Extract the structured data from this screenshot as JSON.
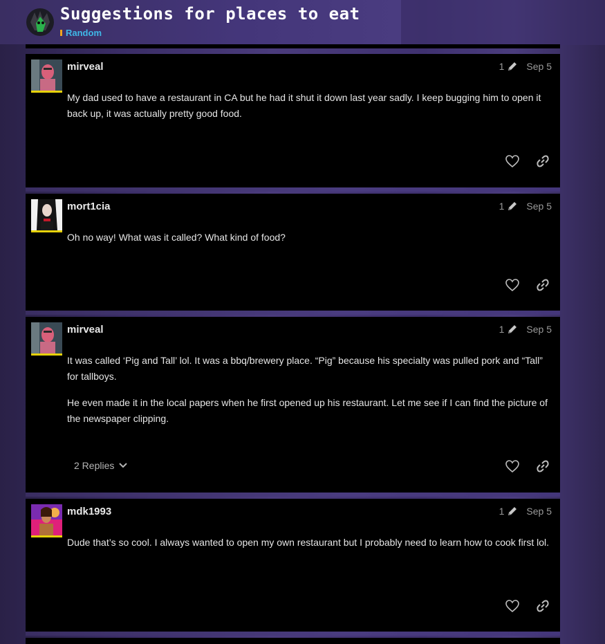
{
  "topic": {
    "title": "Suggestions for places to eat",
    "category": "Random"
  },
  "colors": {
    "accent_user_border": "#e6d20a",
    "category_swatch": "#f0a41f",
    "category_text": "#3fb8e8",
    "post_background": "#000000"
  },
  "icons": {
    "like": "heart-icon",
    "share": "link-icon",
    "edit": "pencil-icon",
    "expand": "chevron-down-icon"
  },
  "posts": [
    {
      "username": "mirveal",
      "edit_count": "1",
      "date": "Sep 5",
      "paragraphs": [
        "My dad used to have a restaurant in CA but he had it shut it down last year sadly. I keep bugging him to open it back up, it was actually pretty good food."
      ]
    },
    {
      "username": "mort1cia",
      "edit_count": "1",
      "date": "Sep 5",
      "paragraphs": [
        "Oh no way! What was it called? What kind of food?"
      ]
    },
    {
      "username": "mirveal",
      "edit_count": "1",
      "date": "Sep 5",
      "paragraphs": [
        "It was called ‘Pig and Tall’ lol. It was a bbq/brewery place. “Pig” because his specialty was pulled pork and “Tall” for tallboys.",
        "He even made it in the local papers when he first opened up his restaurant. Let me see if I can find the picture of the newspaper clipping."
      ],
      "replies_label": "2 Replies"
    },
    {
      "username": "mdk1993",
      "edit_count": "1",
      "date": "Sep 5",
      "paragraphs": [
        "Dude that’s so cool. I always wanted to open my own restaurant but I probably need to learn how to cook first lol."
      ]
    }
  ]
}
